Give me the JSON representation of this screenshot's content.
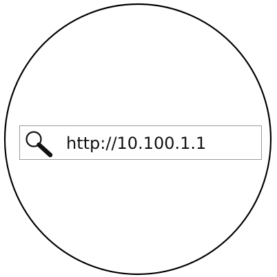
{
  "address_bar": {
    "url": "http://10.100.1.1",
    "icon": "search-icon"
  },
  "colors": {
    "frame_stroke": "#000000",
    "bar_border": "#9a9a9a",
    "text": "#111111"
  }
}
